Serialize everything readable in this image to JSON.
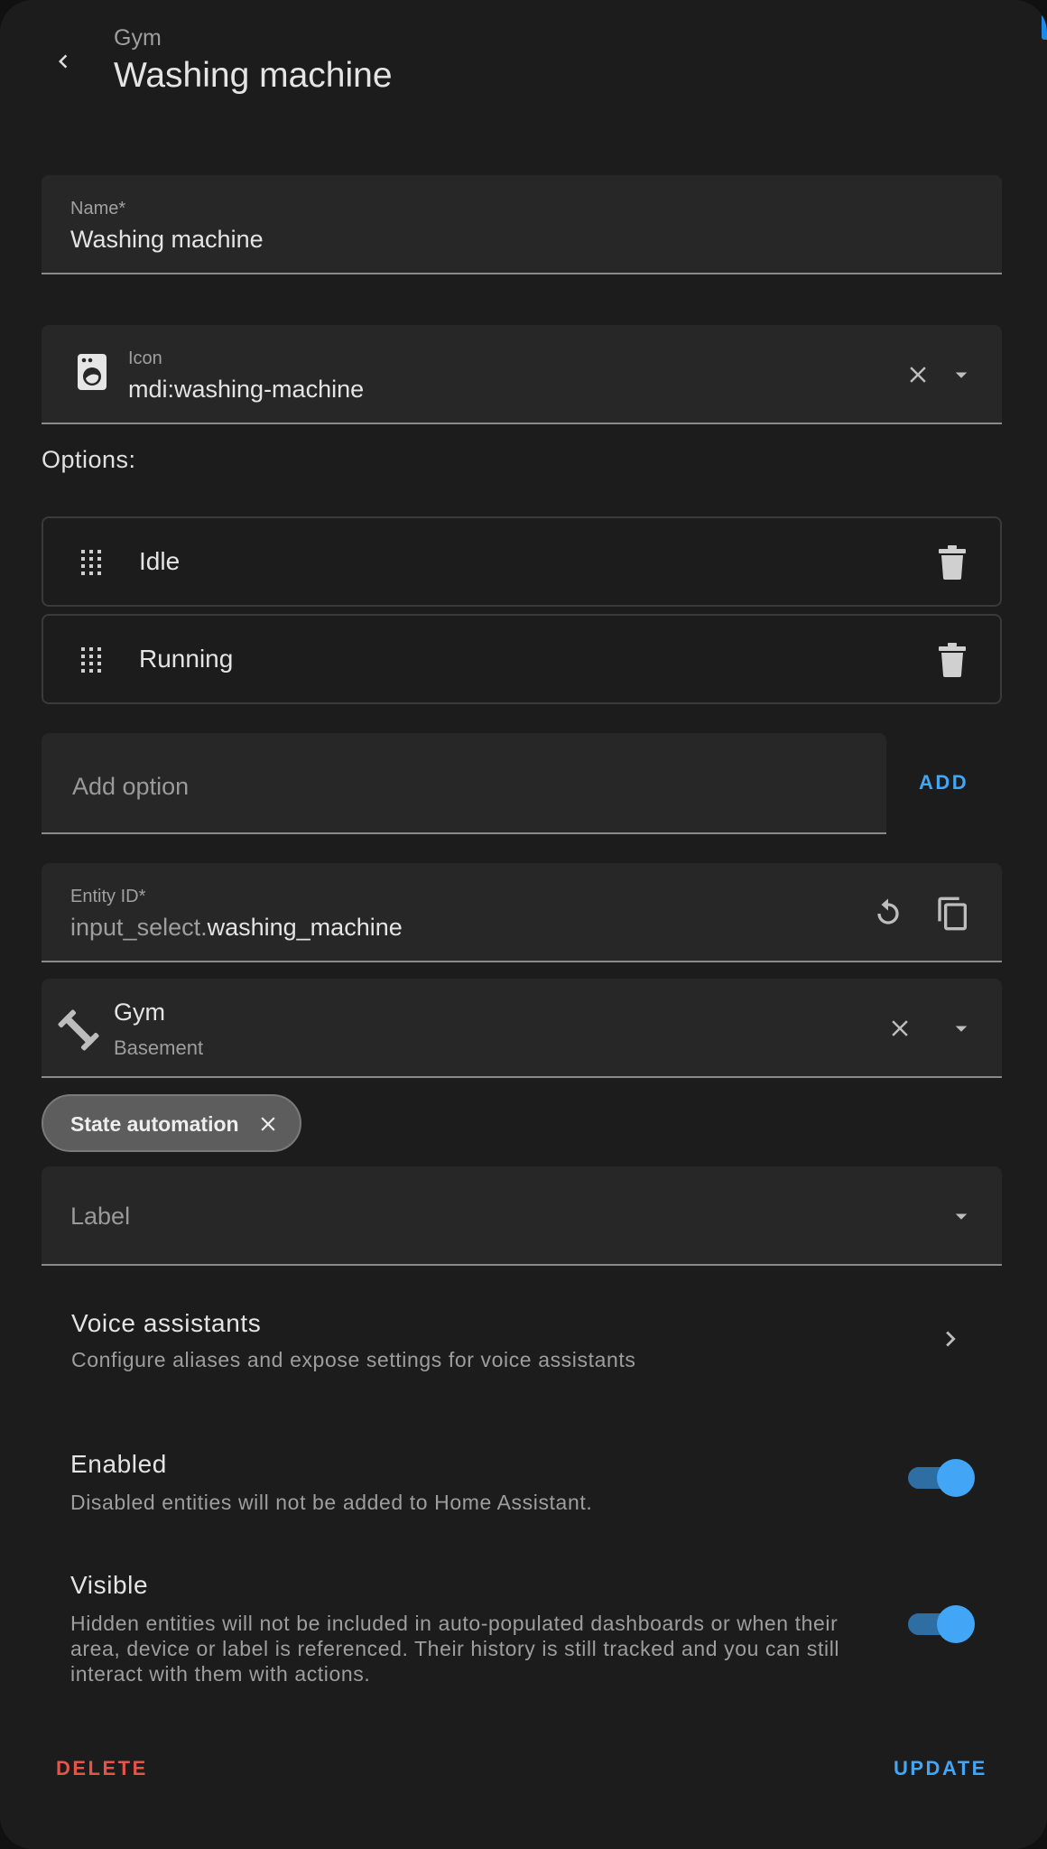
{
  "header": {
    "subtitle": "Gym",
    "title": "Washing machine"
  },
  "name_field": {
    "label": "Name*",
    "value": "Washing machine"
  },
  "icon_field": {
    "label": "Icon",
    "value": "mdi:washing-machine"
  },
  "options": {
    "label": "Options:",
    "items": [
      "Idle",
      "Running"
    ]
  },
  "add_option": {
    "placeholder": "Add option",
    "button_label": "ADD"
  },
  "entity_id": {
    "label": "Entity ID*",
    "prefix": "input_select.",
    "value": "washing_machine"
  },
  "area": {
    "name": "Gym",
    "floor": "Basement"
  },
  "labels": {
    "chip": "State automation",
    "placeholder": "Label"
  },
  "voice": {
    "title": "Voice assistants",
    "desc": "Configure aliases and expose settings for voice assistants"
  },
  "enabled": {
    "title": "Enabled",
    "desc": "Disabled entities will not be added to Home Assistant.",
    "on": true
  },
  "visible": {
    "title": "Visible",
    "desc": "Hidden entities will not be included in auto-populated dashboards or when their area, device or label is referenced. Their history is still tracked and you can still interact with them with actions.",
    "on": true
  },
  "footer": {
    "delete_label": "DELETE",
    "update_label": "UPDATE"
  },
  "colors": {
    "accent": "#42a5f5",
    "danger": "#e5534b",
    "surface": "#1c1c1c",
    "field": "#272727"
  }
}
